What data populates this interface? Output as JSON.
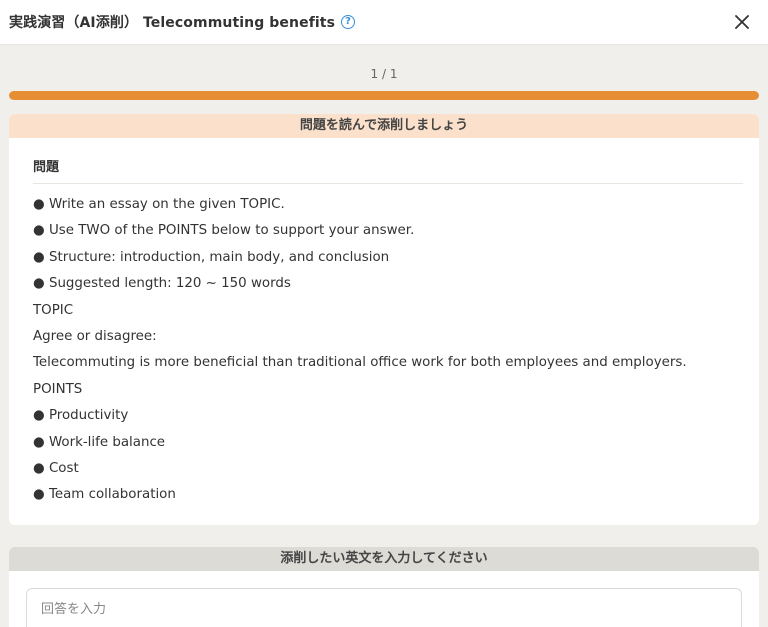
{
  "header": {
    "title": "実践演習（AI添削） Telecommuting benefits",
    "help_glyph": "?",
    "close_glyph": "×"
  },
  "progress": {
    "label": "1 / 1",
    "fraction": 1.0
  },
  "question_card": {
    "header": "問題を読んで添削しましょう",
    "section_title": "問題",
    "lines": [
      "● Write an essay on the given TOPIC.",
      "● Use TWO of the POINTS below to support your answer.",
      "● Structure: introduction, main body, and conclusion",
      "● Suggested length: 120 ~ 150 words",
      "TOPIC",
      "Agree or disagree:",
      "Telecommuting is more beneficial than traditional office work for both employees and employers.",
      "POINTS",
      "● Productivity",
      "● Work-life balance",
      "● Cost",
      "● Team collaboration"
    ]
  },
  "answer_card": {
    "header": "添削したい英文を入力してください",
    "input_placeholder": "回答を入力",
    "input_value": ""
  },
  "colors": {
    "accent": "#e58e33",
    "help_blue": "#3a8fd9",
    "question_header_bg": "#fbe1cb",
    "answer_header_bg": "#dcdbd6"
  }
}
